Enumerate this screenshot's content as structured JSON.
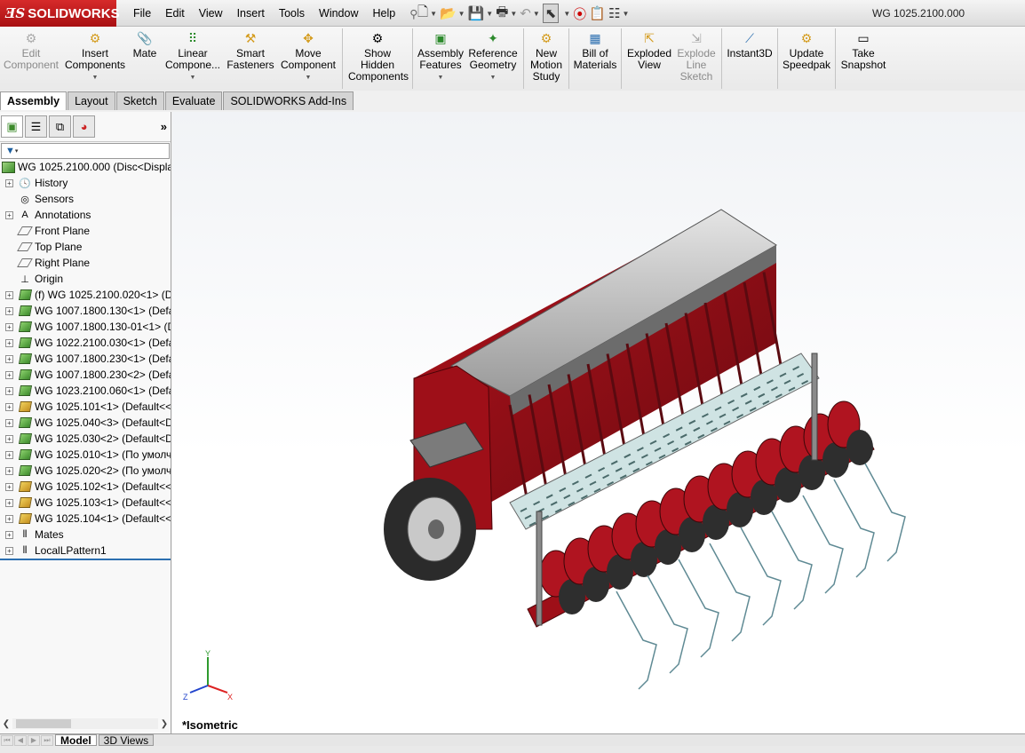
{
  "app": {
    "name": "SOLIDWORKS",
    "brand_color": "#c11a1f"
  },
  "menu": [
    "File",
    "Edit",
    "View",
    "Insert",
    "Tools",
    "Window",
    "Help"
  ],
  "document_title": "WG 1025.2100.000",
  "commands": {
    "edit_component": "Edit Component",
    "insert_components": "Insert Components",
    "mate": "Mate",
    "linear_component": "Linear Compone...",
    "smart_fasteners": "Smart Fasteners",
    "move_component": "Move Component",
    "show_hidden": "Show Hidden Components",
    "assembly_features": "Assembly Features",
    "reference_geometry": "Reference Geometry",
    "new_motion_study": "New Motion Study",
    "bill_of_materials": "Bill of Materials",
    "exploded_view": "Exploded View",
    "explode_line_sketch": "Explode Line Sketch",
    "instant3d": "Instant3D",
    "update_speedpak": "Update Speedpak",
    "take_snapshot": "Take Snapshot"
  },
  "tabs": [
    "Assembly",
    "Layout",
    "Sketch",
    "Evaluate",
    "SOLIDWORKS Add-Ins"
  ],
  "tree": {
    "root": "WG 1025.2100.000  (Disc<Display",
    "items": [
      {
        "label": "History",
        "icon": "history-icon",
        "expandable": true
      },
      {
        "label": "Sensors",
        "icon": "sensor-icon",
        "expandable": false
      },
      {
        "label": "Annotations",
        "icon": "annotation-icon",
        "expandable": true
      },
      {
        "label": "Front Plane",
        "icon": "plane-icon",
        "expandable": false
      },
      {
        "label": "Top Plane",
        "icon": "plane-icon",
        "expandable": false
      },
      {
        "label": "Right Plane",
        "icon": "plane-icon",
        "expandable": false
      },
      {
        "label": "Origin",
        "icon": "origin-icon",
        "expandable": false
      },
      {
        "label": "(f) WG 1025.2100.020<1> (De",
        "icon": "subassembly-icon",
        "expandable": true
      },
      {
        "label": "WG 1007.1800.130<1> (Defau",
        "icon": "subassembly-icon",
        "expandable": true
      },
      {
        "label": "WG 1007.1800.130-01<1> (D",
        "icon": "subassembly-icon",
        "expandable": true
      },
      {
        "label": "WG 1022.2100.030<1> (Defa",
        "icon": "subassembly-icon",
        "expandable": true
      },
      {
        "label": "WG 1007.1800.230<1> (Defa",
        "icon": "subassembly-icon",
        "expandable": true
      },
      {
        "label": "WG 1007.1800.230<2> (Defa",
        "icon": "subassembly-icon",
        "expandable": true
      },
      {
        "label": "WG 1023.2100.060<1> (Defa",
        "icon": "subassembly-icon",
        "expandable": true
      },
      {
        "label": "WG 1025.101<1> (Default<<",
        "icon": "part-icon",
        "expandable": true
      },
      {
        "label": "WG 1025.040<3> (Default<D",
        "icon": "subassembly-icon",
        "expandable": true
      },
      {
        "label": "WG 1025.030<2> (Default<D",
        "icon": "subassembly-icon",
        "expandable": true
      },
      {
        "label": "WG 1025.010<1> (По умолч",
        "icon": "subassembly-icon",
        "expandable": true
      },
      {
        "label": "WG 1025.020<2> (По умолч",
        "icon": "subassembly-icon",
        "expandable": true
      },
      {
        "label": "WG 1025.102<1> (Default<<",
        "icon": "part-icon",
        "expandable": true
      },
      {
        "label": "WG 1025.103<1> (Default<<",
        "icon": "part-icon",
        "expandable": true
      },
      {
        "label": "WG 1025.104<1> (Default<<",
        "icon": "part-icon",
        "expandable": true
      },
      {
        "label": "Mates",
        "icon": "mates-icon",
        "expandable": true
      },
      {
        "label": "LocalLPattern1",
        "icon": "pattern-icon",
        "expandable": true
      }
    ]
  },
  "viewport": {
    "view_name": "*Isometric",
    "triad": {
      "x": "X",
      "y": "Y",
      "z": "Z"
    }
  },
  "bottom_tabs": [
    "Model",
    "3D Views"
  ]
}
